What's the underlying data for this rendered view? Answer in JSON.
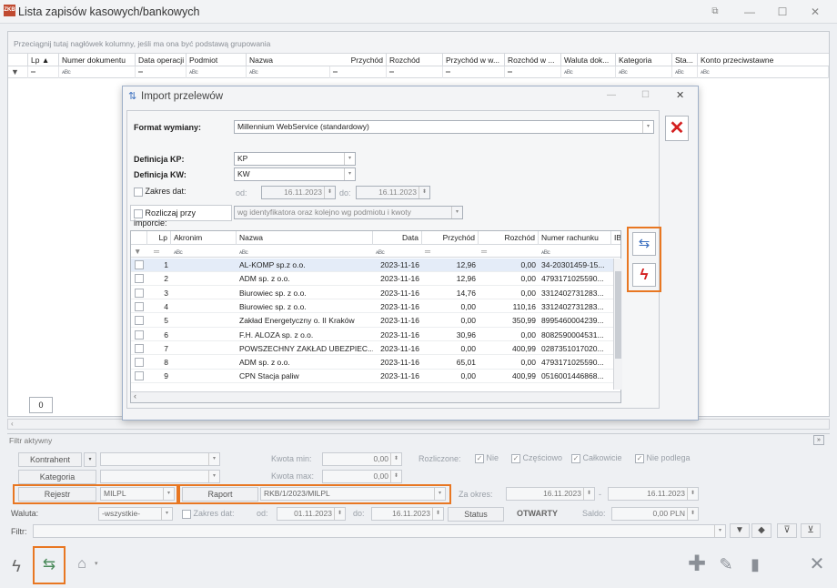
{
  "window": {
    "title": "Lista zapisów kasowych/bankowych",
    "app_badge": "ZKB"
  },
  "grid": {
    "group_hint": "Przeciągnij tutaj nagłówek kolumny, jeśli ma ona być podstawą grupowania",
    "columns": [
      "Lp ▲",
      "Numer dokumentu",
      "Data operacji",
      "Podmiot",
      "Nazwa",
      "Przychód",
      "Rozchód",
      "Przychód w w...",
      "Rozchód w ...",
      "Waluta dok...",
      "Kategoria",
      "Sta...",
      "Konto przeciwstawne"
    ],
    "filter_symbol": "▾",
    "filter_eq": "═",
    "filter_abc": "ᴀBc",
    "count": "0"
  },
  "filter": {
    "header": "Filtr aktywny",
    "kontrahent_btn": "Kontrahent",
    "kategoria_btn": "Kategoria",
    "rejestr_btn": "Rejestr",
    "rejestr_value": "MILPL",
    "raport_btn": "Raport",
    "raport_value": "RKB/1/2023/MILPL",
    "waluta_label": "Waluta:",
    "waluta_value": "-wszystkie-",
    "zakres_label": "Zakres dat:",
    "od_label": "od:",
    "od_value": "01.11.2023",
    "do_label": "do:",
    "do_value": "16.11.2023",
    "kwota_min_label": "Kwota min:",
    "kwota_min_value": "0,00",
    "kwota_max_label": "Kwota max:",
    "kwota_max_value": "0,00",
    "rozliczone_label": "Rozliczone:",
    "opt_nie": "Nie",
    "opt_czesciowo": "Częściowo",
    "opt_calkowicie": "Całkowicie",
    "opt_nie_podlega": "Nie podlega",
    "za_okres_label": "Za okres:",
    "okres_od": "16.11.2023",
    "okres_dash": "-",
    "okres_do": "16.11.2023",
    "status_btn": "Status",
    "status_value": "OTWARTY",
    "saldo_label": "Saldo:",
    "saldo_value": "0,00 PLN",
    "filtr_label": "Filtr:"
  },
  "modal": {
    "title": "Import przelewów",
    "format_label": "Format wymiany:",
    "format_value": "Millennium WebService (standardowy)",
    "kp_label": "Definicja KP:",
    "kp_value": "KP",
    "kw_label": "Definicja KW:",
    "kw_value": "KW",
    "zakres_label": "Zakres dat:",
    "od_label": "od:",
    "od_value": "16.11.2023",
    "do_label": "do:",
    "do_value": "16.11.2023",
    "rozliczaj_label": "Rozliczaj przy imporcie:",
    "rozliczaj_value": "wg identyfikatora oraz kolejno wg podmiotu i kwoty",
    "columns": [
      "Lp",
      "Akronim",
      "Nazwa",
      "Data",
      "Przychód",
      "Rozchód",
      "Numer rachunku",
      "IB/"
    ],
    "rows": [
      {
        "lp": "1",
        "akronim": "",
        "nazwa": "AL-KOMP sp.z o.o.",
        "data": "2023-11-16",
        "przychod": "12,96",
        "rozchod": "0,00",
        "rachunek": "34-20301459-15..."
      },
      {
        "lp": "2",
        "akronim": "",
        "nazwa": "ADM sp. z o.o.",
        "data": "2023-11-16",
        "przychod": "12,96",
        "rozchod": "0,00",
        "rachunek": "4793171025590..."
      },
      {
        "lp": "3",
        "akronim": "",
        "nazwa": "Biurowiec sp. z o.o.",
        "data": "2023-11-16",
        "przychod": "14,76",
        "rozchod": "0,00",
        "rachunek": "3312402731283..."
      },
      {
        "lp": "4",
        "akronim": "",
        "nazwa": "Biurowiec sp. z o.o.",
        "data": "2023-11-16",
        "przychod": "0,00",
        "rozchod": "110,16",
        "rachunek": "3312402731283..."
      },
      {
        "lp": "5",
        "akronim": "",
        "nazwa": "Zakład Energetyczny o. II Kraków",
        "data": "2023-11-16",
        "przychod": "0,00",
        "rozchod": "350,99",
        "rachunek": "8995460004239..."
      },
      {
        "lp": "6",
        "akronim": "",
        "nazwa": "F.H. ALOZA sp. z o.o.",
        "data": "2023-11-16",
        "przychod": "30,96",
        "rozchod": "0,00",
        "rachunek": "8082590004531..."
      },
      {
        "lp": "7",
        "akronim": "",
        "nazwa": "POWSZECHNY ZAKŁAD UBEZPIEC...",
        "data": "2023-11-16",
        "przychod": "0,00",
        "rozchod": "400,99",
        "rachunek": "0287351017020..."
      },
      {
        "lp": "8",
        "akronim": "",
        "nazwa": "ADM sp. z o.o.",
        "data": "2023-11-16",
        "przychod": "65,01",
        "rozchod": "0,00",
        "rachunek": "4793171025590..."
      },
      {
        "lp": "9",
        "akronim": "",
        "nazwa": "CPN Stacja paliw",
        "data": "2023-11-16",
        "przychod": "0,00",
        "rozchod": "400,99",
        "rachunek": "0516001446868..."
      }
    ]
  },
  "colors": {
    "accent_orange": "#e87722",
    "close_red": "#d42020",
    "selected_row": "#e4ecf8"
  }
}
